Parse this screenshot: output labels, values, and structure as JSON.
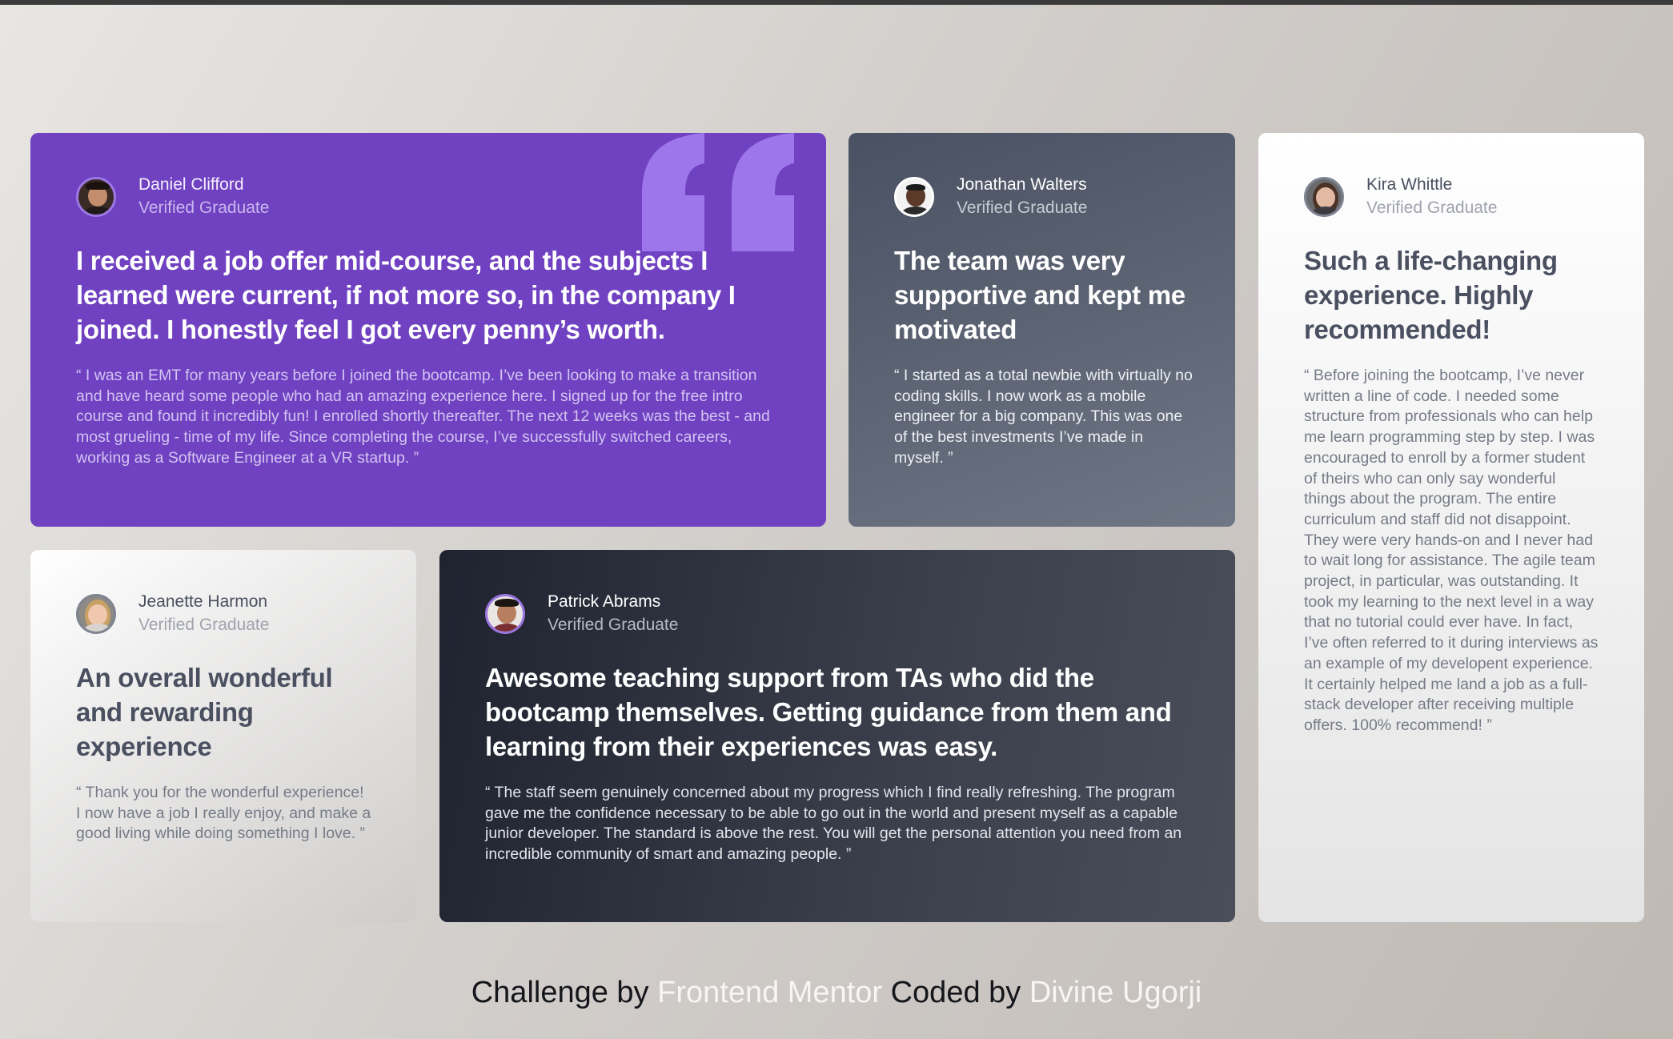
{
  "testimonials": [
    {
      "name": "Daniel Clifford",
      "role": "Verified Graduate",
      "headline": "I received a job offer mid-course, and the subjects I learned were current, if not more so, in the company I joined. I honestly feel I got every penny’s worth.",
      "quote": "“ I was an EMT for many years before I joined the bootcamp. I’ve been looking to make a transition and have heard some people who had an amazing experience here. I signed up for the free intro course and found it incredibly fun! I enrolled shortly thereafter. The next 12 weeks was the best - and most grueling - time of my life. Since completing the course, I’ve successfully switched careers, working as a Software Engineer at a VR startup. ”",
      "accent": "#7042c1"
    },
    {
      "name": "Jonathan Walters",
      "role": "Verified Graduate",
      "headline": "The team was very supportive and kept me motivated",
      "quote": "“ I started as a total newbie with virtually no coding skills. I now work as a mobile engineer for a big company. This was one of the best investments I’ve made in myself. ”",
      "accent": "#48556a"
    },
    {
      "name": "Kira Whittle",
      "role": "Verified Graduate",
      "headline": "Such a life-changing experience. Highly recommended!",
      "quote": "“ Before joining the bootcamp, I’ve never written a line of code. I needed some structure from professionals who can help me learn programming step by step. I was encouraged to enroll by a former student of theirs who can only say wonderful things about the program. The entire curriculum and staff did not disappoint. They were very hands-on and I never had to wait long for assistance. The agile team project, in particular, was outstanding. It took my learning to the next level in a way that no tutorial could ever have. In fact, I’ve often referred to it during interviews as an example of my developent experience. It certainly helped me land a job as a full-stack developer after receiving multiple offers. 100% recommend! ”",
      "accent": "#ffffff"
    },
    {
      "name": "Jeanette Harmon",
      "role": "Verified Graduate",
      "headline": "An overall wonderful and rewarding experience",
      "quote": "“ Thank you for the wonderful experience! I now have a job I really enjoy, and make a good living while doing something I love. ”",
      "accent": "#ffffff"
    },
    {
      "name": "Patrick Abrams",
      "role": "Verified Graduate",
      "headline": "Awesome teaching support from TAs who did the bootcamp themselves. Getting guidance from them and learning from their experiences was easy.",
      "quote": "“ The staff seem genuinely concerned about my progress which I find really refreshing. The program gave me the confidence necessary to be able to go out in the world and present myself as a capable junior developer. The standard is above the rest. You will get the personal attention you need from an incredible community of smart and amazing people. ”",
      "accent": "#19212e"
    }
  ],
  "icons": {
    "quote": "quote-mark-icon",
    "avatar": "avatar-icon"
  },
  "footer": {
    "challenge_prefix": "Challenge by",
    "challenge_link": "Frontend Mentor",
    "coded_prefix": "Coded by",
    "coded_link": "Divine Ugorji"
  }
}
